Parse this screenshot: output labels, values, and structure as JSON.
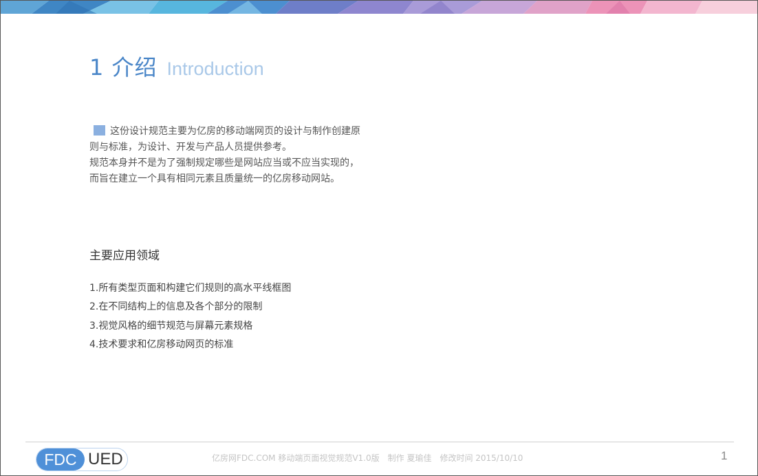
{
  "heading": {
    "number_cn": "1 介绍",
    "english": "Introduction"
  },
  "intro": {
    "paragraph1": "这份设计规范主要为亿房的移动端网页的设计与制作创建原则与标准，为设计、开发与产品人员提供参考。",
    "paragraph2": "规范本身并不是为了强制规定哪些是网站应当或不应当实现的，而旨在建立一个具有相同元素且质量统一的亿房移动网站。"
  },
  "section": {
    "title": "主要应用领域",
    "items": [
      "1.所有类型页面和构建它们规则的高水平线框图",
      "2.在不同结构上的信息及各个部分的限制",
      "3.视觉风格的细节规范与屏幕元素规格",
      "4.技术要求和亿房移动网页的标准"
    ]
  },
  "footer": {
    "logo_left": "FDC",
    "logo_right": "UED",
    "doc_name": "亿房网FDC.COM 移动端页面视觉规范V1.0版",
    "author": "制作 夏瑜佳",
    "modified": "修改时间  2015/10/10",
    "page_number": "1"
  },
  "colors": {
    "heading_blue": "#4a86c8",
    "heading_light_blue": "#a9c8e8",
    "marker_blue": "#8bb0e0",
    "logo_blue": "#4f90d8"
  }
}
